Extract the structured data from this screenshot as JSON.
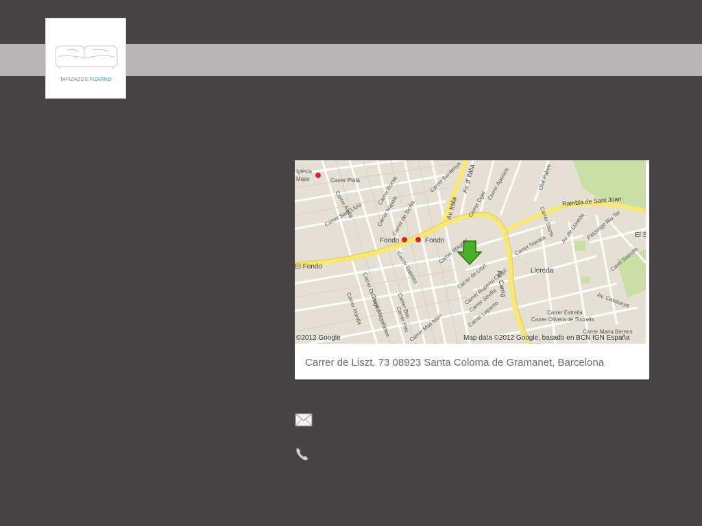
{
  "brand": {
    "name_part1": "TAPIZADOS",
    "name_part2": "PIZARRO",
    "accent_color": "#2e9bd0"
  },
  "colors": {
    "background": "#474344",
    "header_band": "#b8b5b4",
    "road_yellow": "#f7e67a",
    "marker_green": "#4caf2a"
  },
  "map": {
    "labels": {
      "iglesia": "Iglésia",
      "major": "Major",
      "carrer_plata": "Carrer Plata",
      "carrer_roma": "Carrer Roma",
      "carrer_napols": "Carrer Nàpols",
      "carrer_de_sicilia": "Carrer de Sicília",
      "carrer_alella": "Carrer Alella",
      "carrer_sant_lluis": "Carrer Sant Lluís",
      "carrer_sardenya": "Carrer Sardenya",
      "av_italia": "Av. Itàlia",
      "av_d_italia": "Av. d' Itàlia",
      "carrer_ogel": "Carrer Ogel",
      "carrer_apenins": "Carrer Apenins",
      "olof_palme": "Olof Palme",
      "rambla_sant_joan": "Rambla de Sant Joan",
      "fondo_1": "Fondo",
      "fondo_2": "Fondo",
      "el_fondo": "El Fondo",
      "carrer_wagner": "Carrer Wagner",
      "carrer_sturia": "Carrer Sturia",
      "av_de_lloreda": "Av. de Lloreda",
      "passatge_riu_ter": "Passatge Riu Ter",
      "carrer_navata": "Carrer Navata",
      "lloreda": "Lloreda",
      "carrer_dalmau": "Carrer Dalmau",
      "carrer_dr_pages": "Carrer Dr. Pagès",
      "carrer_irlanda": "Carrer Irlanda",
      "carrer_magallanes": "Carrer Magallanes",
      "carrer_buc": "Carrer Buc",
      "carrer_pau": "Carrer Pau",
      "carrer_mas_mari": "Carrer Mas Marí",
      "carrer_de_liszt": "Carrer de Liszt",
      "carrer_ruperto_chapi": "Carrer Ruperto Chapí",
      "carrer_sevilla": "Carrer Sevilla",
      "carrer_lepanto": "Carrer Lepanto",
      "av_carrig": "Av. Carrig",
      "cami_sistrells": "Camí Sistrells",
      "av_catalunya": "Av. Catalunya",
      "carrer_estrella": "Carrer Estrella",
      "carrer_olivera": "Carrer Olivera de Sistrells",
      "carrer_maria_bernes": "Carrer Maria Bernes",
      "el_s": "El S"
    },
    "copyright_left": "©2012 Google",
    "copyright_right": "Map data ©2012 Google, basado en BCN IGN España"
  },
  "address": "Carrer de Liszt, 73 08923 Santa Coloma de Gramanet, Barcelona",
  "icons": {
    "email": "envelope-icon",
    "phone": "phone-icon"
  }
}
